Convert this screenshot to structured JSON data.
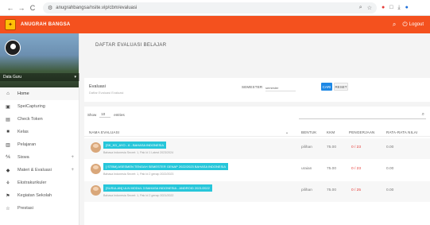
{
  "browser": {
    "url": "anugrahbangsa/nsite.vip/cbm/evaluasi",
    "nav": {
      "back": "←",
      "forward": "→",
      "reload": "C"
    },
    "url_icons": [
      "⌕",
      "☆"
    ],
    "ext_icons": [
      "●",
      "□",
      "⤓",
      "●"
    ]
  },
  "app": {
    "brand": "ANUGRAH BANGSA",
    "logout_label": "Logout"
  },
  "sidebar": {
    "profile_name": "Data Guru",
    "items": [
      {
        "label": "Home",
        "icon": "home-icon",
        "glyph": "⌂",
        "active": true
      },
      {
        "label": "SpeiCapturing",
        "icon": "camera-icon",
        "glyph": "▣"
      },
      {
        "label": "Check Token",
        "icon": "token-icon",
        "glyph": "▤"
      },
      {
        "label": "Kelas",
        "icon": "class-icon",
        "glyph": "■"
      },
      {
        "label": "Pelajaran",
        "icon": "lesson-icon",
        "glyph": "▥"
      },
      {
        "label": "Siswa",
        "icon": "students-icon",
        "glyph": "⅍",
        "expandable": true
      },
      {
        "label": "Materi & Evaluasi",
        "icon": "materials-icon",
        "glyph": "◆",
        "expandable": true
      },
      {
        "label": "Ekstrakurikuler",
        "icon": "extracurricular-icon",
        "glyph": "⚘"
      },
      {
        "label": "Kegiatan Sekolah",
        "icon": "flag-icon",
        "glyph": "⚑"
      },
      {
        "label": "Prestasi",
        "icon": "star-icon",
        "glyph": "☆"
      }
    ]
  },
  "main": {
    "title": "DAFTAR EVALUASI BELAJAR",
    "filter": {
      "heading": "Evaluasi",
      "subheading": "Daftar Evaluasi Evaluasi",
      "semester_label": "SEMESTER",
      "semester_value": "semester",
      "search_button": "CARI",
      "reset_button": "RESET"
    },
    "list": {
      "show_label": "Show",
      "show_value": "10",
      "entries_label": "entries",
      "headers": {
        "name": "NAMA EVALUASI",
        "form": "BENTUK",
        "kkm": "KKM",
        "collection": "PENGERJAAN",
        "average": "RATA-RATA NILAI"
      },
      "rows": [
        {
          "title": "[SK_KD_AYO - 6 - BAHASA INDONESIA",
          "meta": "Bahasa Indonesia   Secret: 1, Pak Id 1   Latest   2023/2024",
          "form": "pilihan",
          "kkm": "75.00",
          "collection": "0 / 23",
          "average": "0.00"
        },
        {
          "title": "[ STBM] ASESMEN TENGAH SEMESTER GENAP 2022/2023 BAHASA INDONESIA",
          "meta": "Bahasa Indonesia   Secret: 1, Pak Id 2   genap   2022/2023",
          "form": "uraian",
          "kkm": "75.00",
          "collection": "0 / 23",
          "average": "0.00"
        },
        {
          "title": "[SUSULAN] ULN MODUL 3 BAHASA INDONESIA - ANDROID 2021/2022",
          "meta": "Bahasa Indonesia   Secret: 1, Pak Id 2   genap   2021/2022",
          "form": "pilihan",
          "kkm": "75.00",
          "collection": "0 / 25",
          "average": "0.00"
        }
      ]
    }
  },
  "colors": {
    "header": "#f4511e",
    "primary": "#1e88e5",
    "badge": "#26c6da",
    "danger": "#e53935"
  }
}
